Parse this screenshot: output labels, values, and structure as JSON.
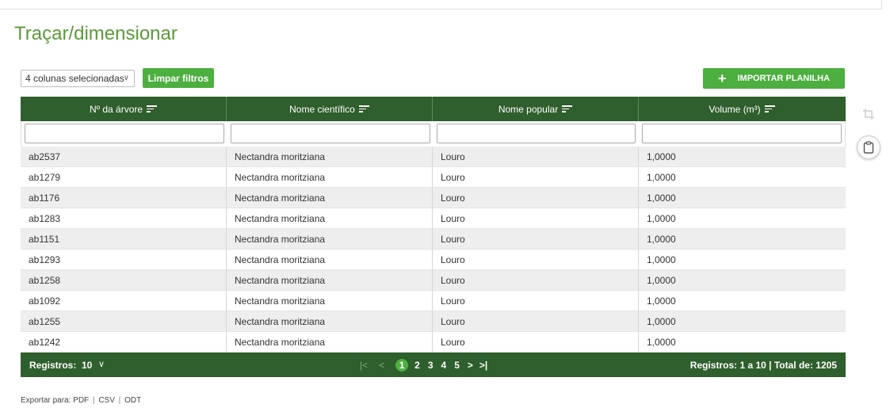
{
  "page": {
    "title": "Traçar/dimensionar"
  },
  "toolbar": {
    "column_select_value": "4 colunas selecionadas",
    "clear_filters_label": "Limpar filtros",
    "import_label": "IMPORTAR PLANILHA"
  },
  "table": {
    "columns": [
      "Nº da árvore",
      "Nome científico",
      "Nome popular",
      "Volume (m³)"
    ],
    "rows": [
      [
        "ab2537",
        "Nectandra moritziana",
        "Louro",
        "1,0000"
      ],
      [
        "ab1279",
        "Nectandra moritziana",
        "Louro",
        "1,0000"
      ],
      [
        "ab1176",
        "Nectandra moritziana",
        "Louro",
        "1,0000"
      ],
      [
        "ab1283",
        "Nectandra moritziana",
        "Louro",
        "1,0000"
      ],
      [
        "ab1151",
        "Nectandra moritziana",
        "Louro",
        "1,0000"
      ],
      [
        "ab1293",
        "Nectandra moritziana",
        "Louro",
        "1,0000"
      ],
      [
        "ab1258",
        "Nectandra moritziana",
        "Louro",
        "1,0000"
      ],
      [
        "ab1092",
        "Nectandra moritziana",
        "Louro",
        "1,0000"
      ],
      [
        "ab1255",
        "Nectandra moritziana",
        "Louro",
        "1,0000"
      ],
      [
        "ab1242",
        "Nectandra moritziana",
        "Louro",
        "1,0000"
      ]
    ]
  },
  "footer": {
    "records_label": "Registros:",
    "page_size": "10",
    "pages": [
      "1",
      "2",
      "3",
      "4",
      "5"
    ],
    "current_page": "1",
    "summary": "Registros: 1 a 10 | Total de: 1205"
  },
  "export": {
    "label": "Exportar para:",
    "pdf": "PDF",
    "csv": "CSV",
    "odt": "ODT",
    "separator": "|"
  },
  "colors": {
    "header_bg": "#2f5f2c",
    "accent_green": "#4caf3f",
    "title_green": "#5a9a3a"
  },
  "icons": {
    "sort": "sort-lines-icon",
    "crop": "crop-icon",
    "clipboard": "clipboard-icon",
    "plus": "plus-icon",
    "chevron": "chevron-down-icon"
  }
}
